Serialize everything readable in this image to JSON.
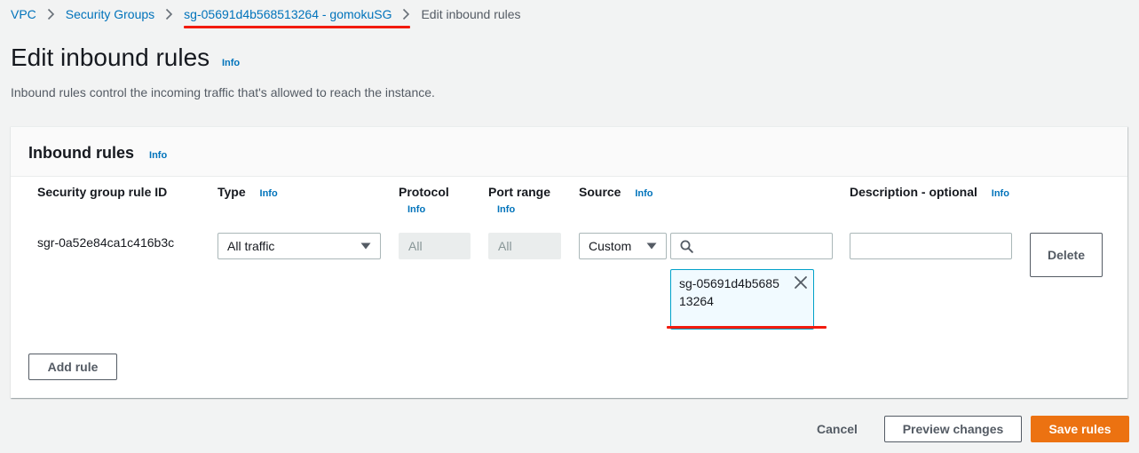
{
  "breadcrumb": {
    "items": [
      "VPC",
      "Security Groups",
      "sg-05691d4b568513264 - gomokuSG"
    ],
    "current": "Edit inbound rules"
  },
  "header": {
    "title": "Edit inbound rules",
    "info": "Info",
    "description": "Inbound rules control the incoming traffic that's allowed to reach the instance."
  },
  "panel": {
    "title": "Inbound rules",
    "info": "Info",
    "columns": {
      "rule_id": "Security group rule ID",
      "type": "Type",
      "protocol": "Protocol",
      "port_range": "Port range",
      "source": "Source",
      "description": "Description - optional"
    },
    "info_label": "Info",
    "rule": {
      "id": "sgr-0a52e84ca1c416b3c",
      "type": "All traffic",
      "protocol": "All",
      "port_range": "All",
      "source_type": "Custom",
      "source_search_value": "",
      "source_token": "sg-05691d4b568513264",
      "description_value": "",
      "delete_label": "Delete"
    },
    "add_rule_label": "Add rule"
  },
  "footer": {
    "cancel_label": "Cancel",
    "preview_label": "Preview changes",
    "save_label": "Save rules"
  },
  "colors": {
    "link": "#0073bb",
    "primary": "#ec7211",
    "highlight_underline": "#f21b0e",
    "token_border": "#00a1c9"
  },
  "icons": [
    "chevron-right-icon",
    "caret-down-icon",
    "search-icon",
    "close-icon"
  ]
}
